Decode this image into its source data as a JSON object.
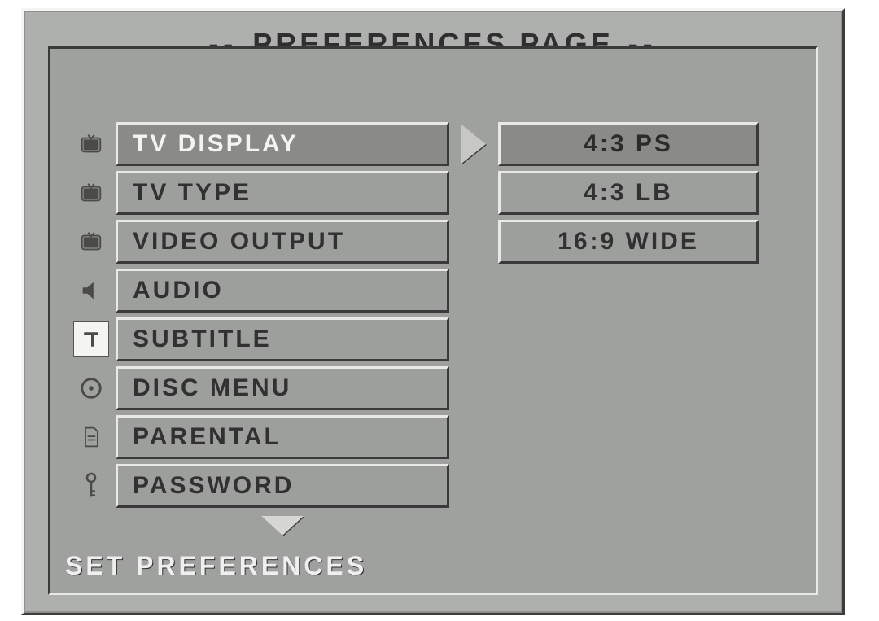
{
  "title": "PREFERENCES PAGE",
  "footer": "SET PREFERENCES",
  "menu": [
    {
      "label": "TV DISPLAY",
      "icon": "tv",
      "selected": true
    },
    {
      "label": "TV TYPE",
      "icon": "tv",
      "selected": false
    },
    {
      "label": "VIDEO OUTPUT",
      "icon": "tv",
      "selected": false
    },
    {
      "label": "AUDIO",
      "icon": "speaker",
      "selected": false
    },
    {
      "label": "SUBTITLE",
      "icon": "text",
      "selected": false,
      "iconHighlighted": true
    },
    {
      "label": "DISC MENU",
      "icon": "disc",
      "selected": false
    },
    {
      "label": "PARENTAL",
      "icon": "doc",
      "selected": false
    },
    {
      "label": "PASSWORD",
      "icon": "key",
      "selected": false
    }
  ],
  "values": [
    {
      "label": "4:3 PS",
      "selected": true
    },
    {
      "label": "4:3 LB",
      "selected": false
    },
    {
      "label": "16:9 WIDE",
      "selected": false
    }
  ]
}
